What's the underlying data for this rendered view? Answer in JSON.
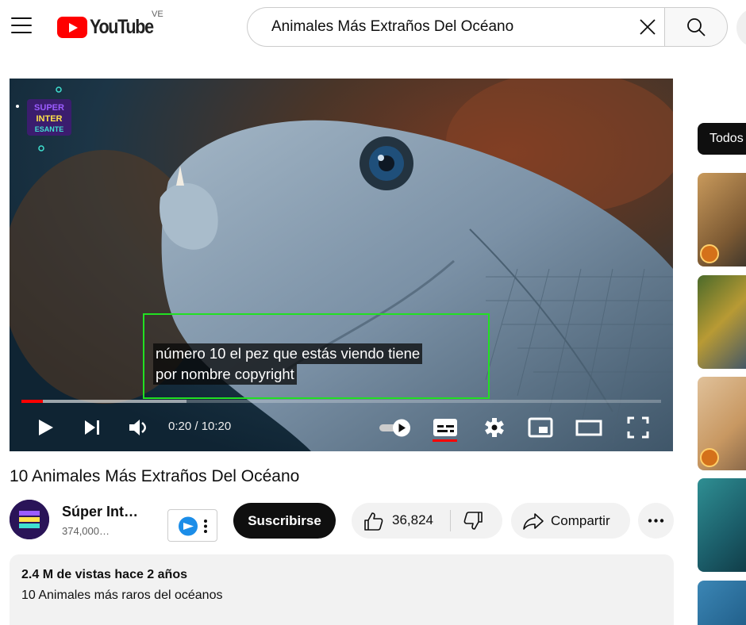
{
  "header": {
    "logo_text": "YouTube",
    "country": "VE",
    "search_value": "Animales Más Extraños Del Océano"
  },
  "player": {
    "caption_line1": "número 10 el pez que estás viendo tiene",
    "caption_line2": "por nombre copyright",
    "time": "0:20 / 10:20",
    "progress_played_fraction": 0.033,
    "progress_loaded_fraction": 0.258,
    "logo_text": "SUPER INTERESANTE"
  },
  "video": {
    "title": "10 Animales Más Extraños Del Océano",
    "channel_name": "Súper Int…",
    "subscribers": "374,000…",
    "subscribe_label": "Suscribirse",
    "likes": "36,824",
    "share_label": "Compartir"
  },
  "description": {
    "stats": "2.4 M de vistas  hace 2 años",
    "text": "10 Animales más raros del océanos"
  },
  "sidebar": {
    "chip_label": "Todos"
  },
  "colors": {
    "brand_red": "#ff0000",
    "subtitle_highlight": "#22e022"
  }
}
